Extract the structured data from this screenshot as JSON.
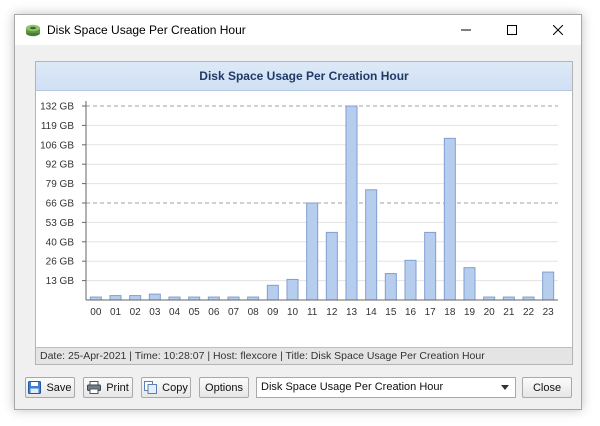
{
  "window": {
    "title": "Disk Space Usage Per Creation Hour",
    "controls": {
      "minimize": "minimize",
      "maximize": "maximize",
      "close": "close"
    }
  },
  "chart_panel": {
    "header": "Disk Space Usage Per Creation Hour",
    "status": "Date: 25-Apr-2021 | Time: 10:28:07 | Host: flexcore | Title: Disk Space Usage Per Creation Hour"
  },
  "chart_data": {
    "type": "bar",
    "title": "Disk Space Usage Per Creation Hour",
    "xlabel": "",
    "ylabel": "",
    "categories": [
      "00",
      "01",
      "02",
      "03",
      "04",
      "05",
      "06",
      "07",
      "08",
      "09",
      "10",
      "11",
      "12",
      "13",
      "14",
      "15",
      "16",
      "17",
      "18",
      "19",
      "20",
      "21",
      "22",
      "23"
    ],
    "values": [
      2,
      3,
      3,
      4,
      2,
      2,
      2,
      2,
      2,
      10,
      14,
      66,
      46,
      132,
      75,
      18,
      27,
      46,
      110,
      22,
      2,
      2,
      2,
      19
    ],
    "unit": "GB",
    "ylim": [
      0,
      132
    ],
    "yticks": [
      "13 GB",
      "26 GB",
      "40 GB",
      "53 GB",
      "66 GB",
      "79 GB",
      "92 GB",
      "106 GB",
      "119 GB",
      "132 GB"
    ],
    "ytick_values": [
      13.2,
      26.4,
      39.6,
      52.8,
      66,
      79.2,
      92.4,
      105.6,
      118.8,
      132
    ],
    "grid": true,
    "bar_color": "#b7cdee",
    "bar_border": "#7f9fd1"
  },
  "toolbar": {
    "save_label": "Save",
    "print_label": "Print",
    "copy_label": "Copy",
    "options_label": "Options",
    "chart_select_value": "Disk Space Usage Per Creation Hour",
    "close_label": "Close"
  }
}
